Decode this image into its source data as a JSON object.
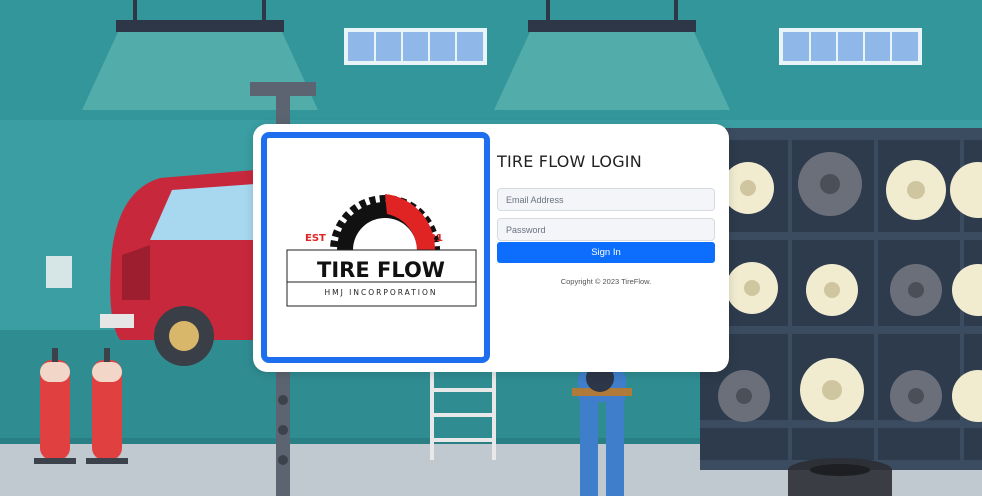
{
  "logo": {
    "est_label": "EST",
    "year": "2021",
    "brand": "TIRE FLOW",
    "tagline": "HMJ INCORPORATION"
  },
  "login": {
    "title": "TIRE FLOW LOGIN",
    "email_placeholder": "Email Address",
    "password_placeholder": "Password",
    "submit_label": "Sign In",
    "copyright": "Copyright © 2023 TireFlow."
  },
  "colors": {
    "primary": "#0d6efd",
    "logo_frame": "#1e6ff0",
    "accent_red": "#e02424",
    "wall_teal": "#3a9ea2"
  }
}
